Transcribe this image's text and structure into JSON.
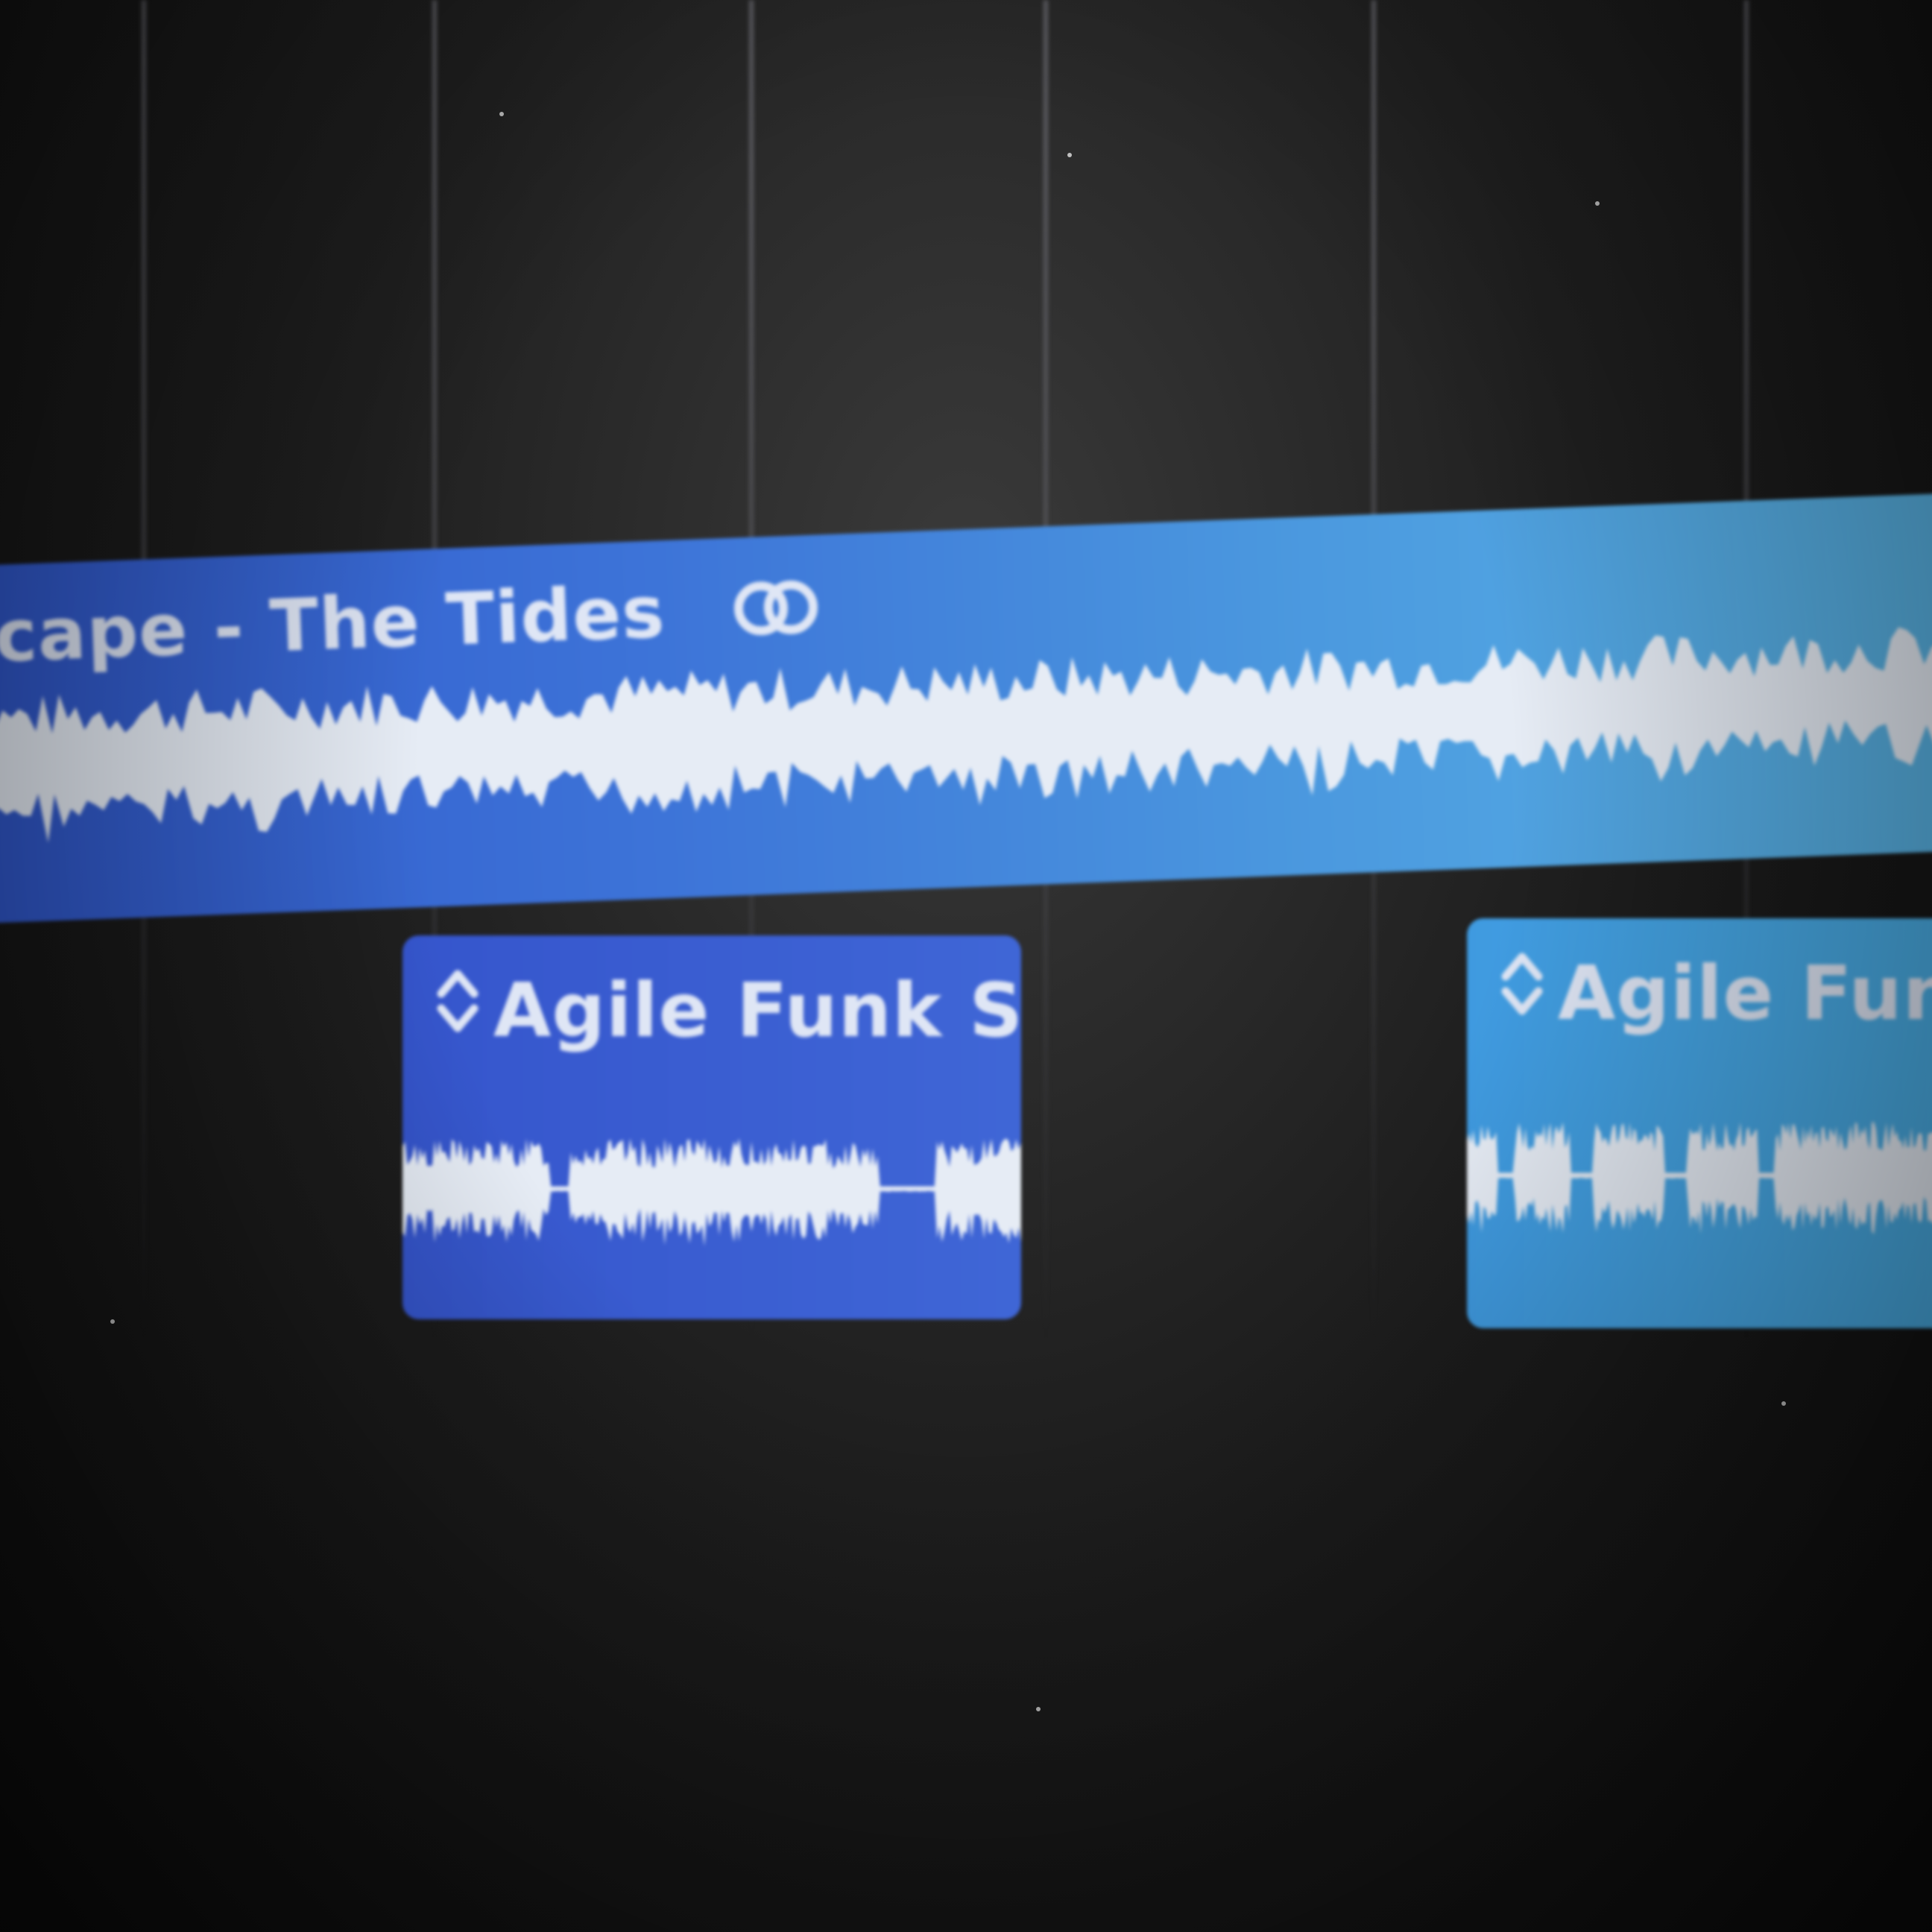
{
  "regions": [
    {
      "title": "scape - The Tides",
      "icon": "loop-icon",
      "color": "#3d74d8"
    },
    {
      "title": "Agile Funk Syn",
      "icon": "updown-arrows-icon",
      "color": "#3f66d6"
    },
    {
      "title": "Agile Fun",
      "icon": "updown-arrows-icon",
      "color": "#4bb0e6"
    }
  ],
  "colors": {
    "background": "#1a1a1a",
    "waveform": "#e6ecf5",
    "gridline": "#8c8c96"
  }
}
